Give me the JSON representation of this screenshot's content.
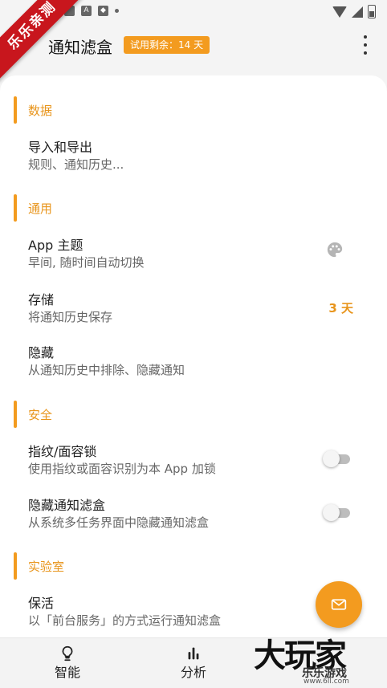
{
  "ribbon": {
    "text": "乐乐亲测"
  },
  "appbar": {
    "title": "通知滤盒",
    "trial_badge": "试用剩余：14 天",
    "menu_icon": "more-vert-icon"
  },
  "sections": [
    {
      "title": "数据",
      "items": [
        {
          "title": "导入和导出",
          "subtitle": "规则、通知历史..."
        }
      ]
    },
    {
      "title": "通用",
      "items": [
        {
          "title": "App 主题",
          "subtitle": "早间, 随时间自动切换",
          "trailing_icon": "palette-icon"
        },
        {
          "title": "存储",
          "subtitle": "将通知历史保存",
          "value": "3 天"
        },
        {
          "title": "隐藏",
          "subtitle": "从通知历史中排除、隐藏通知"
        }
      ]
    },
    {
      "title": "安全",
      "items": [
        {
          "title": "指纹/面容锁",
          "subtitle": "使用指纹或面容识别为本 App 加锁",
          "toggle": false
        },
        {
          "title": "隐藏通知滤盒",
          "subtitle": "从系统多任务界面中隐藏通知滤盒",
          "toggle": false
        }
      ]
    },
    {
      "title": "实验室",
      "items": [
        {
          "title": "保活",
          "subtitle": "以「前台服务」的方式运行通知滤盒"
        }
      ]
    }
  ],
  "fab": {
    "icon": "mail-icon"
  },
  "bottom_nav": [
    {
      "label": "智能",
      "icon": "lightbulb-icon"
    },
    {
      "label": "分析",
      "icon": "bar-chart-icon"
    }
  ],
  "watermark": {
    "main": "大玩家",
    "sub": "乐乐游戏",
    "url": "www.6ll.com"
  },
  "colors": {
    "accent": "#f39b1f",
    "background": "#f4f4f4",
    "sheet": "#ffffff"
  }
}
